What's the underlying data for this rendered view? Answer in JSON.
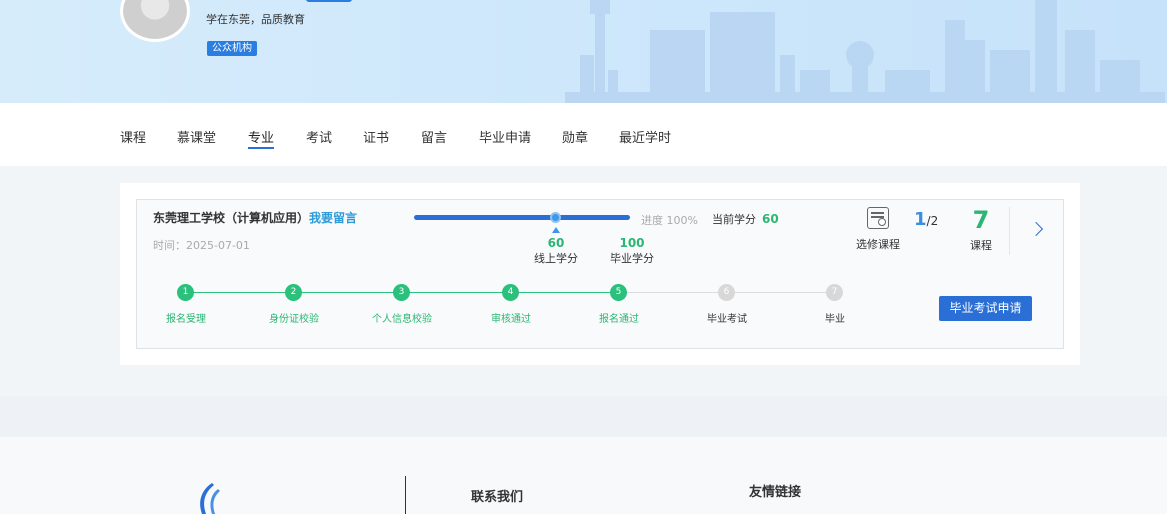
{
  "header": {
    "slogan": "学在东莞，品质教育",
    "org_badge": "公众机构"
  },
  "nav": {
    "items": [
      "课程",
      "慕课堂",
      "专业",
      "考试",
      "证书",
      "留言",
      "毕业申请",
      "勋章",
      "最近学时"
    ],
    "active": "专业"
  },
  "program": {
    "school": "东莞理工学校（计算机应用）",
    "message_link": "我要留言",
    "date_label": "时间：",
    "date": "2025-07-01",
    "progress_text": "进度 100%",
    "progress": 1.0,
    "current_credit_label": "当前学分",
    "current_credit": "60",
    "online_credit_value": "60",
    "online_credit_label": "线上学分",
    "grad_credit_value": "100",
    "grad_credit_label": "毕业学分",
    "elective_label": "选修课程",
    "elective_num": "1",
    "elective_den": "/2",
    "course_count": "7",
    "course_label": "课程",
    "apply_button": "毕业考试申请"
  },
  "steps": [
    {
      "num": "1",
      "label": "报名受理",
      "done": true
    },
    {
      "num": "2",
      "label": "身份证校验",
      "done": true
    },
    {
      "num": "3",
      "label": "个人信息校验",
      "done": true
    },
    {
      "num": "4",
      "label": "审核通过",
      "done": true
    },
    {
      "num": "5",
      "label": "报名通过",
      "done": true
    },
    {
      "num": "6",
      "label": "毕业考试",
      "done": false
    },
    {
      "num": "7",
      "label": "毕业",
      "done": false
    }
  ],
  "footer": {
    "contact": "联系我们",
    "links": "友情链接"
  },
  "colors": {
    "primary": "#2a6fd6",
    "success": "#2bb673",
    "banner": "#cfe8fb"
  }
}
